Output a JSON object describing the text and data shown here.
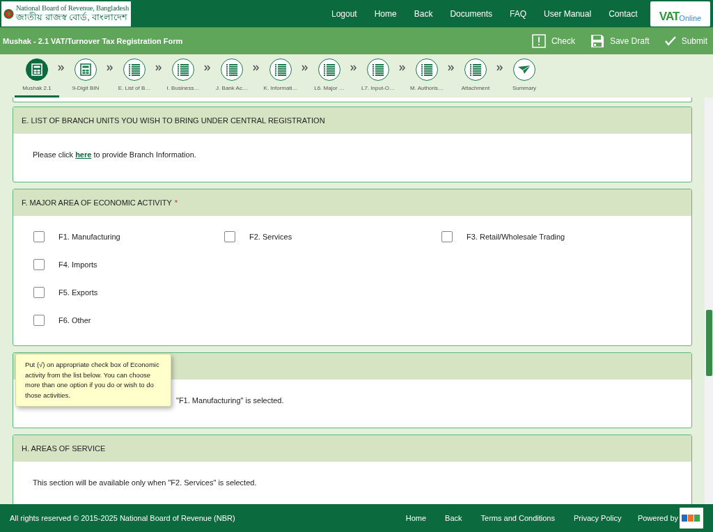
{
  "header": {
    "logo_en": "National Board of Revenue, Bangladesh",
    "logo_bn": "জাতীয় রাজস্ব বোর্ড, বাংলাদেশ",
    "nav": [
      "Logout",
      "Home",
      "Back",
      "Documents",
      "FAQ",
      "User Manual",
      "Contact"
    ],
    "vat_logo": {
      "mark": "VAT",
      "suffix": "Online"
    }
  },
  "title_bar": {
    "title": "Mushak - 2.1 VAT/Turnover Tax Registration Form",
    "actions": [
      {
        "label": "Check",
        "kind": "check"
      },
      {
        "label": "Save Draft",
        "kind": "save"
      },
      {
        "label": "Submit",
        "kind": "submit"
      }
    ]
  },
  "steps": [
    {
      "label": "Mushak 2.1",
      "kind": "calculator",
      "selected": true
    },
    {
      "label": "9-Digit BIN",
      "kind": "calculator",
      "selected": false
    },
    {
      "label": "E. List of B…",
      "kind": "list",
      "selected": false
    },
    {
      "label": "I. Business…",
      "kind": "list",
      "selected": false
    },
    {
      "label": "J. Bank Ac…",
      "kind": "list",
      "selected": false
    },
    {
      "label": "K. Informati…",
      "kind": "list",
      "selected": false
    },
    {
      "label": "L6. Major …",
      "kind": "list",
      "selected": false
    },
    {
      "label": "L7. Input-O…",
      "kind": "list",
      "selected": false
    },
    {
      "label": "M. Authoris…",
      "kind": "list",
      "selected": false
    },
    {
      "label": "Attachment",
      "kind": "list",
      "selected": false
    },
    {
      "label": "Summary",
      "kind": "plane",
      "selected": false
    }
  ],
  "sections": [
    {
      "kind": "link_note",
      "title": "E. LIST OF BRANCH UNITS YOU WISH TO BRING UNDER CENTRAL REGISTRATION",
      "before": "Please click",
      "link": "here",
      "after": "to provide Branch Information."
    },
    {
      "kind": "options",
      "title": "F. MAJOR AREA OF ECONOMIC ACTIVITY",
      "required_mark": "*",
      "options": [
        {
          "label": "F1. Manufacturing",
          "checked": false
        },
        {
          "label": "F2. Services",
          "checked": false
        },
        {
          "label": "F3. Retail/Wholesale Trading",
          "checked": false
        },
        {
          "label": "F4. Imports",
          "checked": false
        },
        {
          "label": "F5. Exports",
          "checked": false
        },
        {
          "label": "F6. Other",
          "checked": false
        }
      ]
    },
    {
      "kind": "covered_note",
      "text": "\"F1. Manufacturing\" is selected."
    },
    {
      "kind": "note",
      "title": "H. AREAS OF SERVICE",
      "text": "This section will be available only when \"F2. Services\" is selected."
    }
  ],
  "tooltip": "Put (√) on appropriate check box of Economic activity from the list below. You can choose more than one option if you do or wish to do those activities.",
  "footer": {
    "copyright": "All rights reserved © 2015-2025 National Board of Revenue (NBR)",
    "links": [
      "Home",
      "Back",
      "Terms and Conditions",
      "Privacy Policy"
    ],
    "powered_by": "Powered by"
  }
}
